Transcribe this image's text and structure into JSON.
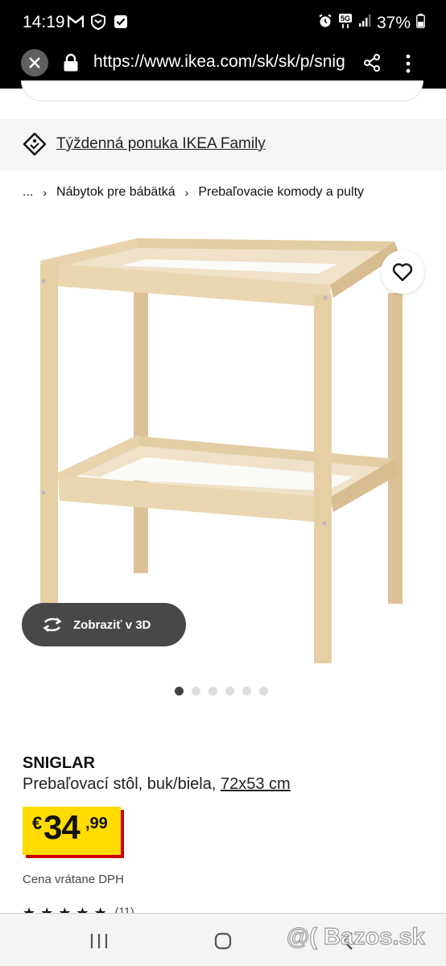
{
  "status_bar": {
    "time": "14:19",
    "battery": "37%",
    "network": "5G"
  },
  "browser": {
    "url": "https://www.ikea.com/sk/sk/p/sniglar"
  },
  "family_banner": {
    "text": "Týždenná ponuka IKEA Family"
  },
  "breadcrumb": {
    "items": [
      "...",
      "Nábytok pre bábätká",
      "Prebaľovacie komody a pulty"
    ]
  },
  "gallery": {
    "view_3d_label": "Zobraziť v 3D",
    "image_count": 6,
    "active_index": 0
  },
  "product": {
    "name": "SNIGLAR",
    "description": "Prebaľovací stôl, buk/biela, ",
    "size": "72x53 cm",
    "price_currency": "€",
    "price_integer": "34",
    "price_decimal": ",99",
    "vat_note": "Cena vrátane DPH",
    "rating_stars": 5,
    "review_count": "(11)"
  },
  "watermark": "@( Bazos.sk",
  "colors": {
    "price_bg": "#ffdb00",
    "price_shadow": "#cc0008",
    "wood": "#e6cfa5"
  }
}
